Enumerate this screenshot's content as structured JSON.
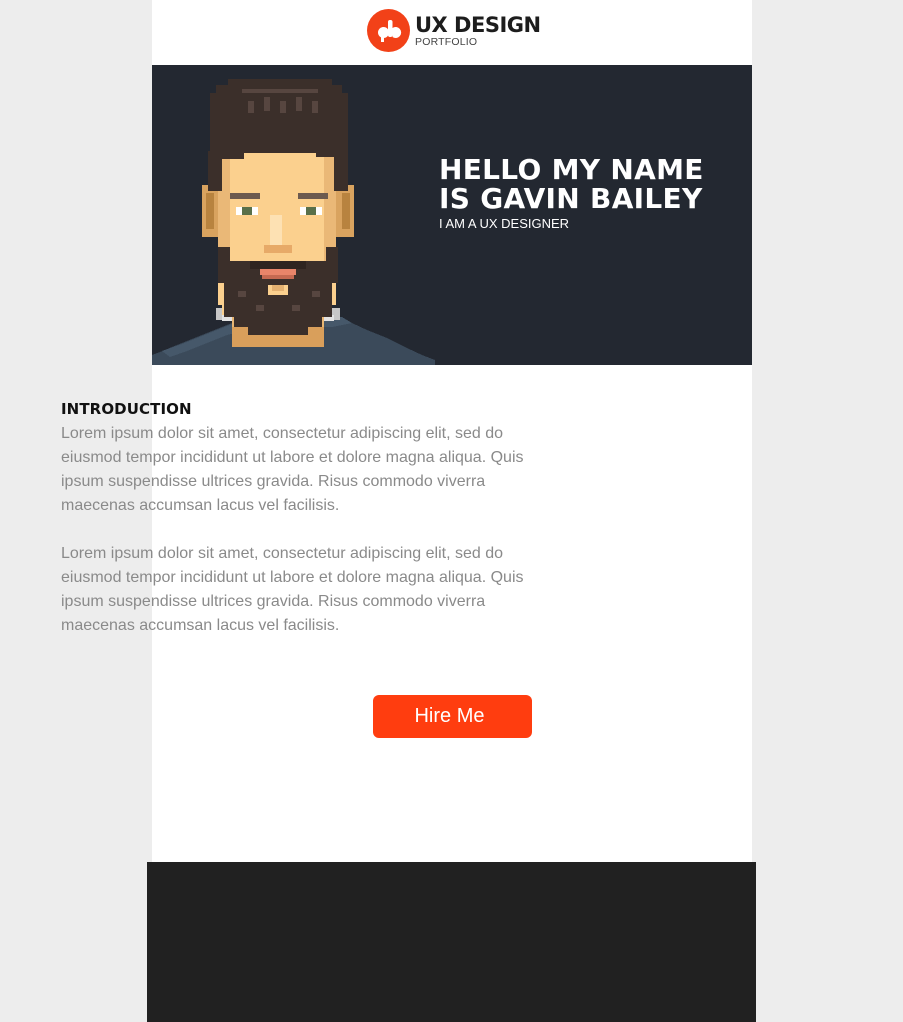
{
  "brand": {
    "title": "UX DESIGN",
    "subtitle": "PORTFOLIO",
    "icon": "logo-mark-icon",
    "accent_color": "#f24118"
  },
  "hero": {
    "title": "HELLO MY NAME IS GAVIN BAILEY",
    "subtitle": "I AM A UX DESIGNER",
    "background_color": "#232831",
    "image": "pixel-art-avatar"
  },
  "introduction": {
    "heading": "INTRODUCTION",
    "paragraphs": [
      "Lorem ipsum dolor sit amet, consectetur adipiscing elit, sed do eiusmod tempor incididunt ut labore et dolore magna aliqua. Quis ipsum suspendisse ultrices gravida. Risus commodo viverra maecenas accumsan lacus vel facilisis.",
      "Lorem ipsum dolor sit amet, consectetur adipiscing elit, sed do eiusmod tempor incididunt ut labore et dolore magna aliqua. Quis ipsum suspendisse ultrices gravida. Risus commodo viverra maecenas accumsan lacus vel facilisis."
    ]
  },
  "cta": {
    "label": "Hire Me",
    "color": "#ff3d0f"
  },
  "footer": {
    "background_color": "#212121"
  }
}
